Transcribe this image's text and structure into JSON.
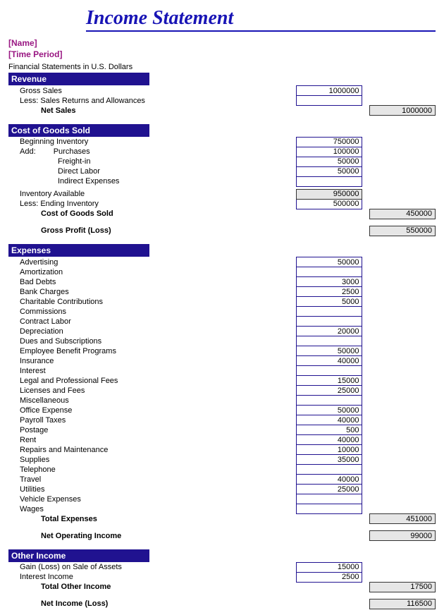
{
  "title": "Income Statement",
  "meta": {
    "name": "[Name]",
    "period": "[Time Period]"
  },
  "subnote": "Financial Statements in U.S. Dollars",
  "sections": {
    "revenue": {
      "header": "Revenue",
      "gross_sales_label": "Gross Sales",
      "gross_sales": "1000000",
      "less_returns_label": "Less: Sales Returns and Allowances",
      "less_returns": "",
      "net_sales_label": "Net Sales",
      "net_sales": "1000000"
    },
    "cogs": {
      "header": "Cost of Goods Sold",
      "beginning_inv_label": "Beginning Inventory",
      "beginning_inv": "750000",
      "add_label": "Add:",
      "purchases_label": "Purchases",
      "purchases": "100000",
      "freight_label": "Freight-in",
      "freight": "50000",
      "direct_labor_label": "Direct Labor",
      "direct_labor": "50000",
      "indirect_label": "Indirect Expenses",
      "indirect": "",
      "inv_available_label": "Inventory Available",
      "inv_available": "950000",
      "ending_inv_label": "Less: Ending Inventory",
      "ending_inv": "500000",
      "cogs_label": "Cost of Goods Sold",
      "cogs_total": "450000",
      "gross_profit_label": "Gross Profit (Loss)",
      "gross_profit": "550000"
    },
    "expenses": {
      "header": "Expenses",
      "items": [
        {
          "label": "Advertising",
          "value": "50000"
        },
        {
          "label": "Amortization",
          "value": ""
        },
        {
          "label": "Bad Debts",
          "value": "3000"
        },
        {
          "label": "Bank Charges",
          "value": "2500"
        },
        {
          "label": "Charitable Contributions",
          "value": "5000"
        },
        {
          "label": "Commissions",
          "value": ""
        },
        {
          "label": "Contract Labor",
          "value": ""
        },
        {
          "label": "Depreciation",
          "value": "20000"
        },
        {
          "label": "Dues and Subscriptions",
          "value": ""
        },
        {
          "label": "Employee Benefit Programs",
          "value": "50000"
        },
        {
          "label": "Insurance",
          "value": "40000"
        },
        {
          "label": "Interest",
          "value": ""
        },
        {
          "label": "Legal and Professional Fees",
          "value": "15000"
        },
        {
          "label": "Licenses and Fees",
          "value": "25000"
        },
        {
          "label": "Miscellaneous",
          "value": ""
        },
        {
          "label": "Office Expense",
          "value": "50000"
        },
        {
          "label": "Payroll Taxes",
          "value": "40000"
        },
        {
          "label": "Postage",
          "value": "500"
        },
        {
          "label": "Rent",
          "value": "40000"
        },
        {
          "label": "Repairs and Maintenance",
          "value": "10000"
        },
        {
          "label": "Supplies",
          "value": "35000"
        },
        {
          "label": "Telephone",
          "value": ""
        },
        {
          "label": "Travel",
          "value": "40000"
        },
        {
          "label": "Utilities",
          "value": "25000"
        },
        {
          "label": "Vehicle Expenses",
          "value": ""
        },
        {
          "label": "Wages",
          "value": ""
        }
      ],
      "total_label": "Total Expenses",
      "total": "451000",
      "net_op_label": "Net Operating Income",
      "net_op": "99000"
    },
    "other": {
      "header": "Other Income",
      "gain_label": "Gain (Loss) on Sale of Assets",
      "gain": "15000",
      "interest_label": "Interest Income",
      "interest": "2500",
      "total_label": "Total Other Income",
      "total": "17500",
      "net_income_label": "Net Income (Loss)",
      "net_income": "116500"
    }
  }
}
